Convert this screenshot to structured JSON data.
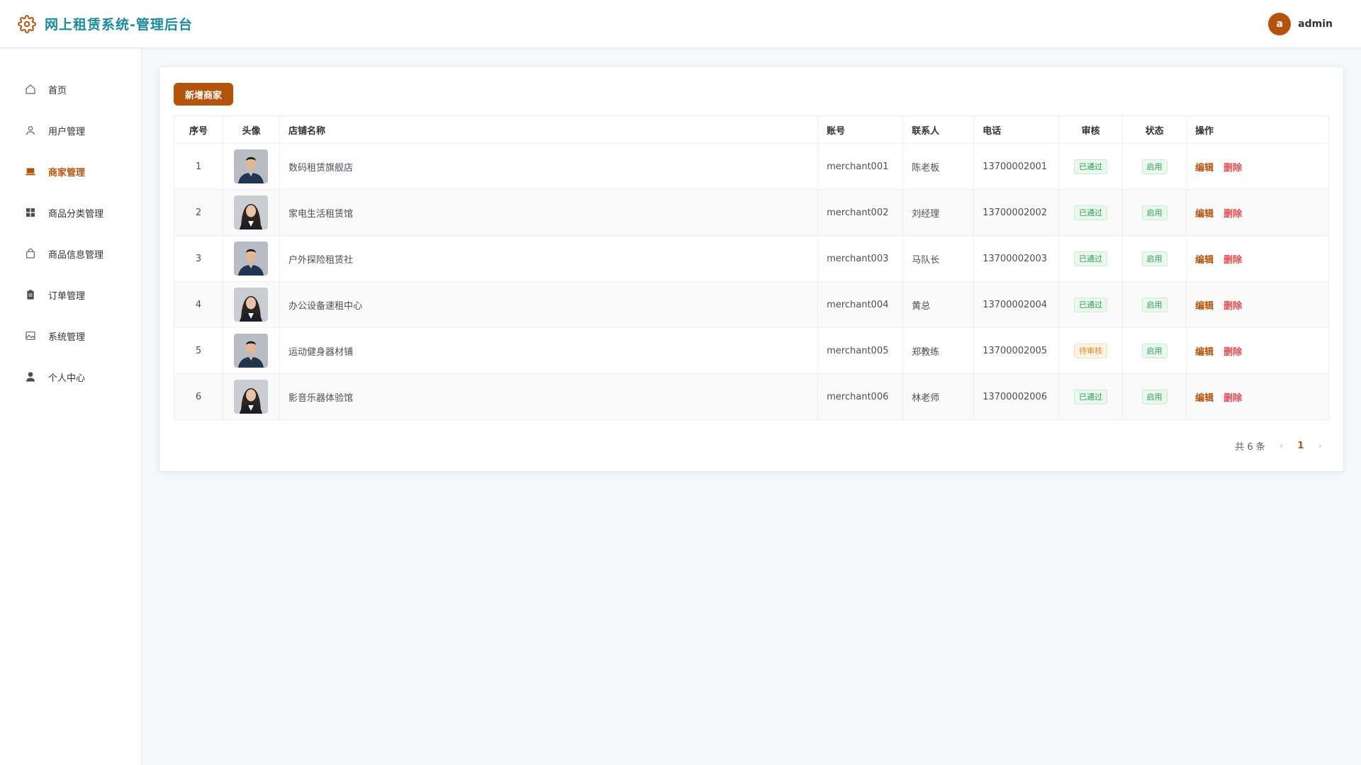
{
  "header": {
    "title": "网上租赁系统-管理后台",
    "user_initial": "a",
    "username": "admin",
    "brand_color": "#1d8a9a",
    "accent_color": "#b4530b"
  },
  "sidebar": {
    "items": [
      {
        "label": "首页",
        "icon": "home-icon"
      },
      {
        "label": "用户管理",
        "icon": "user-icon"
      },
      {
        "label": "商家管理",
        "icon": "shop-icon",
        "active": true
      },
      {
        "label": "商品分类管理",
        "icon": "grid-icon"
      },
      {
        "label": "商品信息管理",
        "icon": "bag-icon"
      },
      {
        "label": "订单管理",
        "icon": "clipboard-icon"
      },
      {
        "label": "系统管理",
        "icon": "image-icon"
      },
      {
        "label": "个人中心",
        "icon": "person-icon"
      }
    ]
  },
  "toolbar": {
    "add_label": "新增商家"
  },
  "table": {
    "columns": [
      "序号",
      "头像",
      "店铺名称",
      "账号",
      "联系人",
      "电话",
      "审核",
      "状态",
      "操作"
    ],
    "rows": [
      {
        "index": "1",
        "avatar": "male-avatar",
        "shop": "数码租赁旗舰店",
        "account": "merchant001",
        "contact": "陈老板",
        "phone": "13700002001",
        "review": "已通过",
        "status": "启用"
      },
      {
        "index": "2",
        "avatar": "female-avatar",
        "shop": "家电生活租赁馆",
        "account": "merchant002",
        "contact": "刘经理",
        "phone": "13700002002",
        "review": "已通过",
        "status": "启用"
      },
      {
        "index": "3",
        "avatar": "male-avatar",
        "shop": "户外探险租赁社",
        "account": "merchant003",
        "contact": "马队长",
        "phone": "13700002003",
        "review": "已通过",
        "status": "启用"
      },
      {
        "index": "4",
        "avatar": "female-avatar",
        "shop": "办公设备速租中心",
        "account": "merchant004",
        "contact": "黄总",
        "phone": "13700002004",
        "review": "已通过",
        "status": "启用"
      },
      {
        "index": "5",
        "avatar": "male-avatar",
        "shop": "运动健身器材铺",
        "account": "merchant005",
        "contact": "郑教练",
        "phone": "13700002005",
        "review": "待审核",
        "status": "启用"
      },
      {
        "index": "6",
        "avatar": "female-avatar",
        "shop": "影音乐器体验馆",
        "account": "merchant006",
        "contact": "林老师",
        "phone": "13700002006",
        "review": "已通过",
        "status": "启用"
      }
    ],
    "edit_label": "编辑",
    "delete_label": "删除"
  },
  "pagination": {
    "total_text": "共 6 条",
    "current_page": "1",
    "prev": "‹",
    "next": "›"
  }
}
